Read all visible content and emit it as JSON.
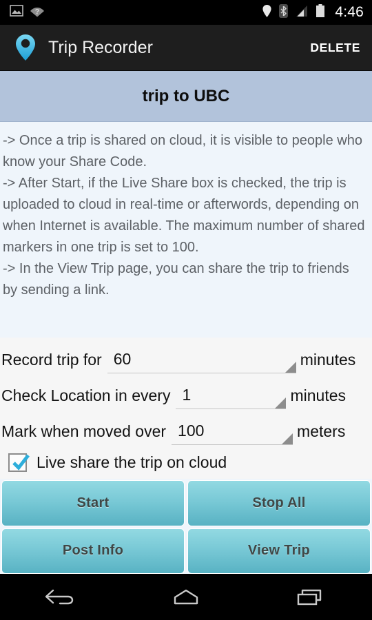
{
  "statusbar": {
    "time": "4:46",
    "left_icons": [
      {
        "name": "screenshot-image-icon"
      },
      {
        "name": "wifi-unknown-icon"
      }
    ],
    "right_icons": [
      {
        "name": "location-pin-icon"
      },
      {
        "name": "bluetooth-icon"
      },
      {
        "name": "cellular-signal-icon"
      },
      {
        "name": "battery-icon"
      }
    ]
  },
  "actionbar": {
    "app_icon": "map-pin-icon",
    "title": "Trip Recorder",
    "delete_label": "DELETE"
  },
  "titleband": {
    "trip_name": "trip to UBC"
  },
  "instructions": {
    "text": "-> Once a trip is shared on cloud, it is visible to people who know your Share Code.\n-> After Start, if the Live Share box is checked, the trip is uploaded to cloud in real-time or afterwords, depending on when Internet is available. The maximum number of shared markers in one trip is set to 100.\n-> In the View Trip page, you can share the trip to friends by sending a link."
  },
  "form": {
    "rows": [
      {
        "label": "Record trip for",
        "value": "60",
        "unit": "minutes"
      },
      {
        "label": "Check Location in every",
        "value": "1",
        "unit": "minutes"
      },
      {
        "label": "Mark when moved over",
        "value": "100",
        "unit": "meters"
      }
    ],
    "checkbox": {
      "label": "Live share the trip on cloud",
      "checked": true
    }
  },
  "buttons": [
    {
      "label": "Start"
    },
    {
      "label": "Stop All"
    },
    {
      "label": "Post Info"
    },
    {
      "label": "View Trip"
    }
  ],
  "navbar": {
    "back": "back-icon",
    "home": "home-icon",
    "recents": "recents-icon"
  },
  "colors": {
    "accent_teal": "#79c9d6",
    "title_band": "#b2c3db",
    "instruction_bg": "#eff5fb",
    "form_bg": "#f6f6f6",
    "actionbar_bg": "#1e1e1e",
    "checkbox_check": "#2eaedb"
  }
}
